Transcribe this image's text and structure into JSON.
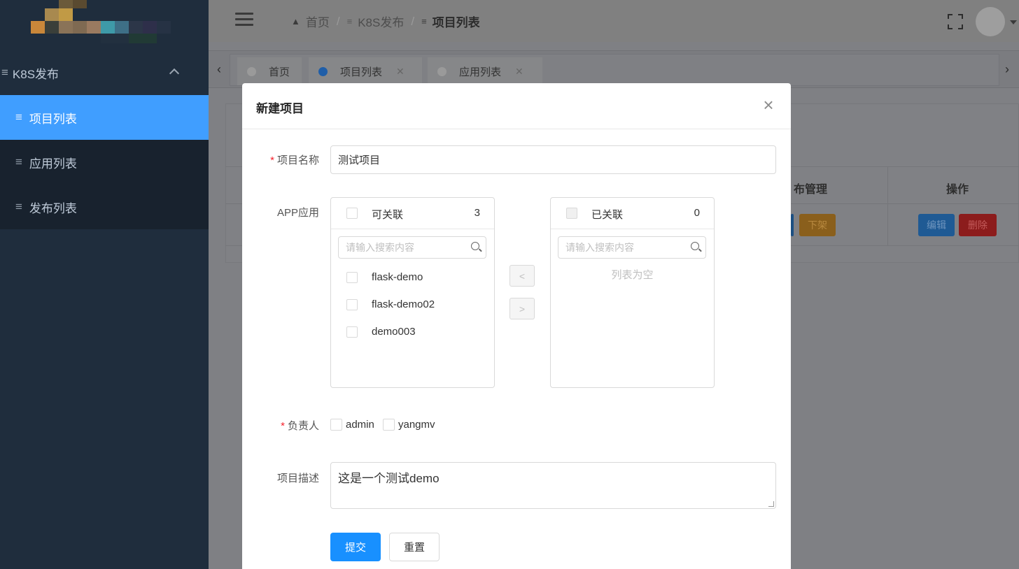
{
  "sidebar": {
    "group_label": "K8S发布",
    "items": [
      {
        "label": "项目列表",
        "active": true
      },
      {
        "label": "应用列表",
        "active": false
      },
      {
        "label": "发布列表",
        "active": false
      }
    ]
  },
  "navbar": {
    "breadcrumb": [
      "首页",
      "K8S发布",
      "项目列表"
    ]
  },
  "tags": [
    {
      "label": "首页",
      "closable": false,
      "active": false
    },
    {
      "label": "项目列表",
      "closable": true,
      "active": true
    },
    {
      "label": "应用列表",
      "closable": true,
      "active": false
    }
  ],
  "background_table": {
    "headers": [
      "布管理",
      "操作"
    ],
    "row_buttons": [
      "下架",
      "编辑",
      "删除"
    ]
  },
  "modal": {
    "title": "新建项目",
    "project_name_label": "项目名称",
    "project_name_value": "测试项目",
    "app_label": "APP应用",
    "transfer": {
      "left_title": "可关联",
      "left_count": "3",
      "right_title": "已关联",
      "right_count": "0",
      "search_placeholder": "请输入搜索内容",
      "left_items": [
        "flask-demo",
        "flask-demo02",
        "demo003"
      ],
      "right_empty_text": "列表为空",
      "move_left": "<",
      "move_right": ">"
    },
    "owner_label": "负责人",
    "owners": [
      "admin",
      "yangmv"
    ],
    "desc_label": "项目描述",
    "desc_value": "这是一个测试demo",
    "submit_label": "提交",
    "reset_label": "重置"
  },
  "colors": {
    "sidebar_bg": "#1f2d3d",
    "menu_active": "#409eff",
    "primary": "#1890ff",
    "required": "#f5222d"
  }
}
